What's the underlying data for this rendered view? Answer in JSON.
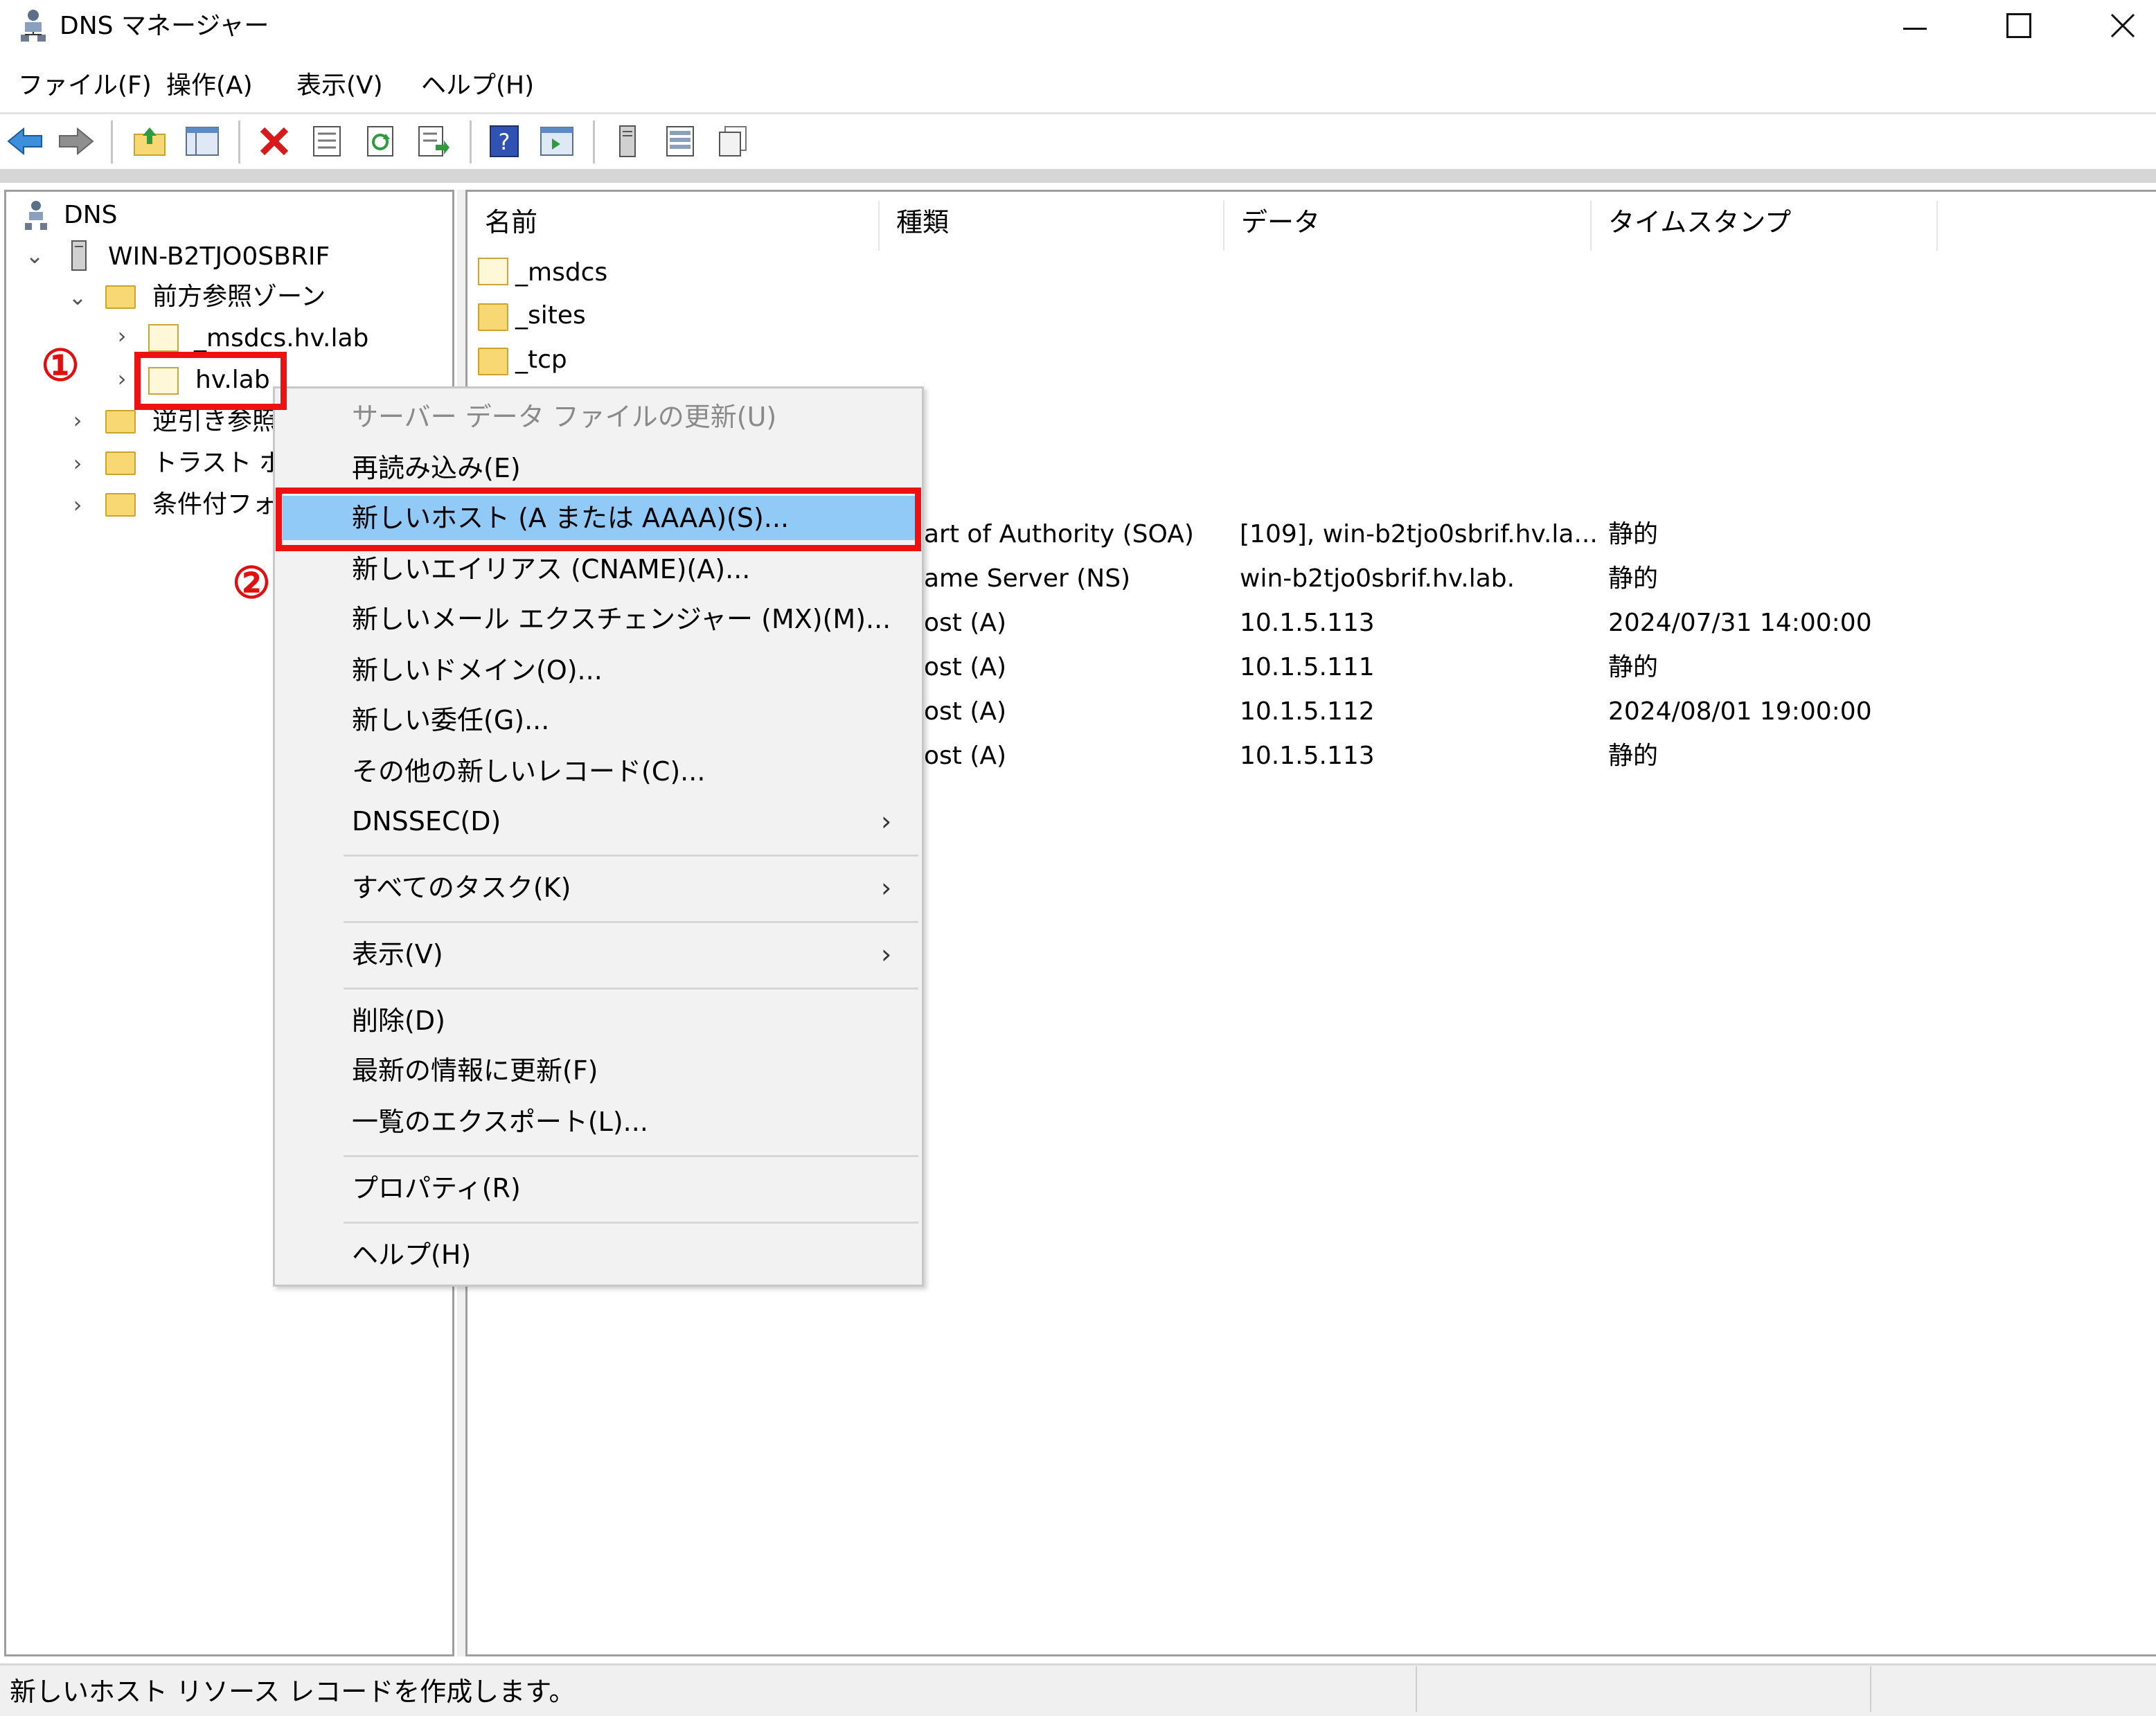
{
  "window": {
    "title": "DNS マネージャー",
    "controls": {
      "minimize": "—",
      "maximize": "☐",
      "close": "✕"
    }
  },
  "menubar": [
    "ファイル(F)",
    "操作(A)",
    "表示(V)",
    "ヘルプ(H)"
  ],
  "toolbar": {
    "icons": [
      "back-arrow-icon",
      "forward-arrow-icon",
      "up-folder-icon",
      "show-hide-tree-icon",
      "delete-icon",
      "properties-icon",
      "refresh-icon",
      "export-list-icon",
      "help-icon",
      "action-pane-icon",
      "server-icon",
      "record-list-icon",
      "copy-record-icon"
    ]
  },
  "tree": {
    "root": "DNS",
    "server": "WIN-B2TJO0SBRIF",
    "forward_zones": "前方参照ゾーン",
    "zone_msdcs": "_msdcs.hv.lab",
    "zone_hvlab": "hv.lab",
    "reverse_zones": "逆引き参照",
    "trust_points": "トラスト ポイ",
    "conditional_forwarders": "条件付フォ"
  },
  "list": {
    "columns": [
      "名前",
      "種類",
      "データ",
      "タイムスタンプ"
    ],
    "folders": [
      "_msdcs",
      "_sites",
      "_tcp"
    ],
    "rows": [
      {
        "type": "art of Authority (SOA)",
        "data": "[109], win-b2tjo0sbrif.hv.la...",
        "timestamp": "静的"
      },
      {
        "type": "ame Server (NS)",
        "data": "win-b2tjo0sbrif.hv.lab.",
        "timestamp": "静的"
      },
      {
        "type": "ost (A)",
        "data": "10.1.5.113",
        "timestamp": "2024/07/31 14:00:00"
      },
      {
        "type": "ost (A)",
        "data": "10.1.5.111",
        "timestamp": "静的"
      },
      {
        "type": "ost (A)",
        "data": "10.1.5.112",
        "timestamp": "2024/08/01 19:00:00"
      },
      {
        "type": "ost (A)",
        "data": "10.1.5.113",
        "timestamp": "静的"
      }
    ]
  },
  "context_menu": {
    "update_server_file": "サーバー データ ファイルの更新(U)",
    "reload": "再読み込み(E)",
    "new_host": "新しいホスト (A または AAAA)(S)...",
    "new_alias": "新しいエイリアス (CNAME)(A)...",
    "new_mx": "新しいメール エクスチェンジャー (MX)(M)...",
    "new_domain": "新しいドメイン(O)...",
    "new_delegation": "新しい委任(G)...",
    "other_records": "その他の新しいレコード(C)...",
    "dnssec": "DNSSEC(D)",
    "all_tasks": "すべてのタスク(K)",
    "view": "表示(V)",
    "delete": "削除(D)",
    "refresh": "最新の情報に更新(F)",
    "export_list": "一覧のエクスポート(L)...",
    "properties": "プロパティ(R)",
    "help": "ヘルプ(H)",
    "submenu_arrow": "›"
  },
  "annotations": {
    "step1": "①",
    "step2": "②"
  },
  "status": {
    "text": "新しいホスト リソース レコードを作成します。"
  },
  "colors": {
    "highlight": "#91c9f7",
    "annotation_red": "#ee1111",
    "folder": "#f7d873"
  }
}
